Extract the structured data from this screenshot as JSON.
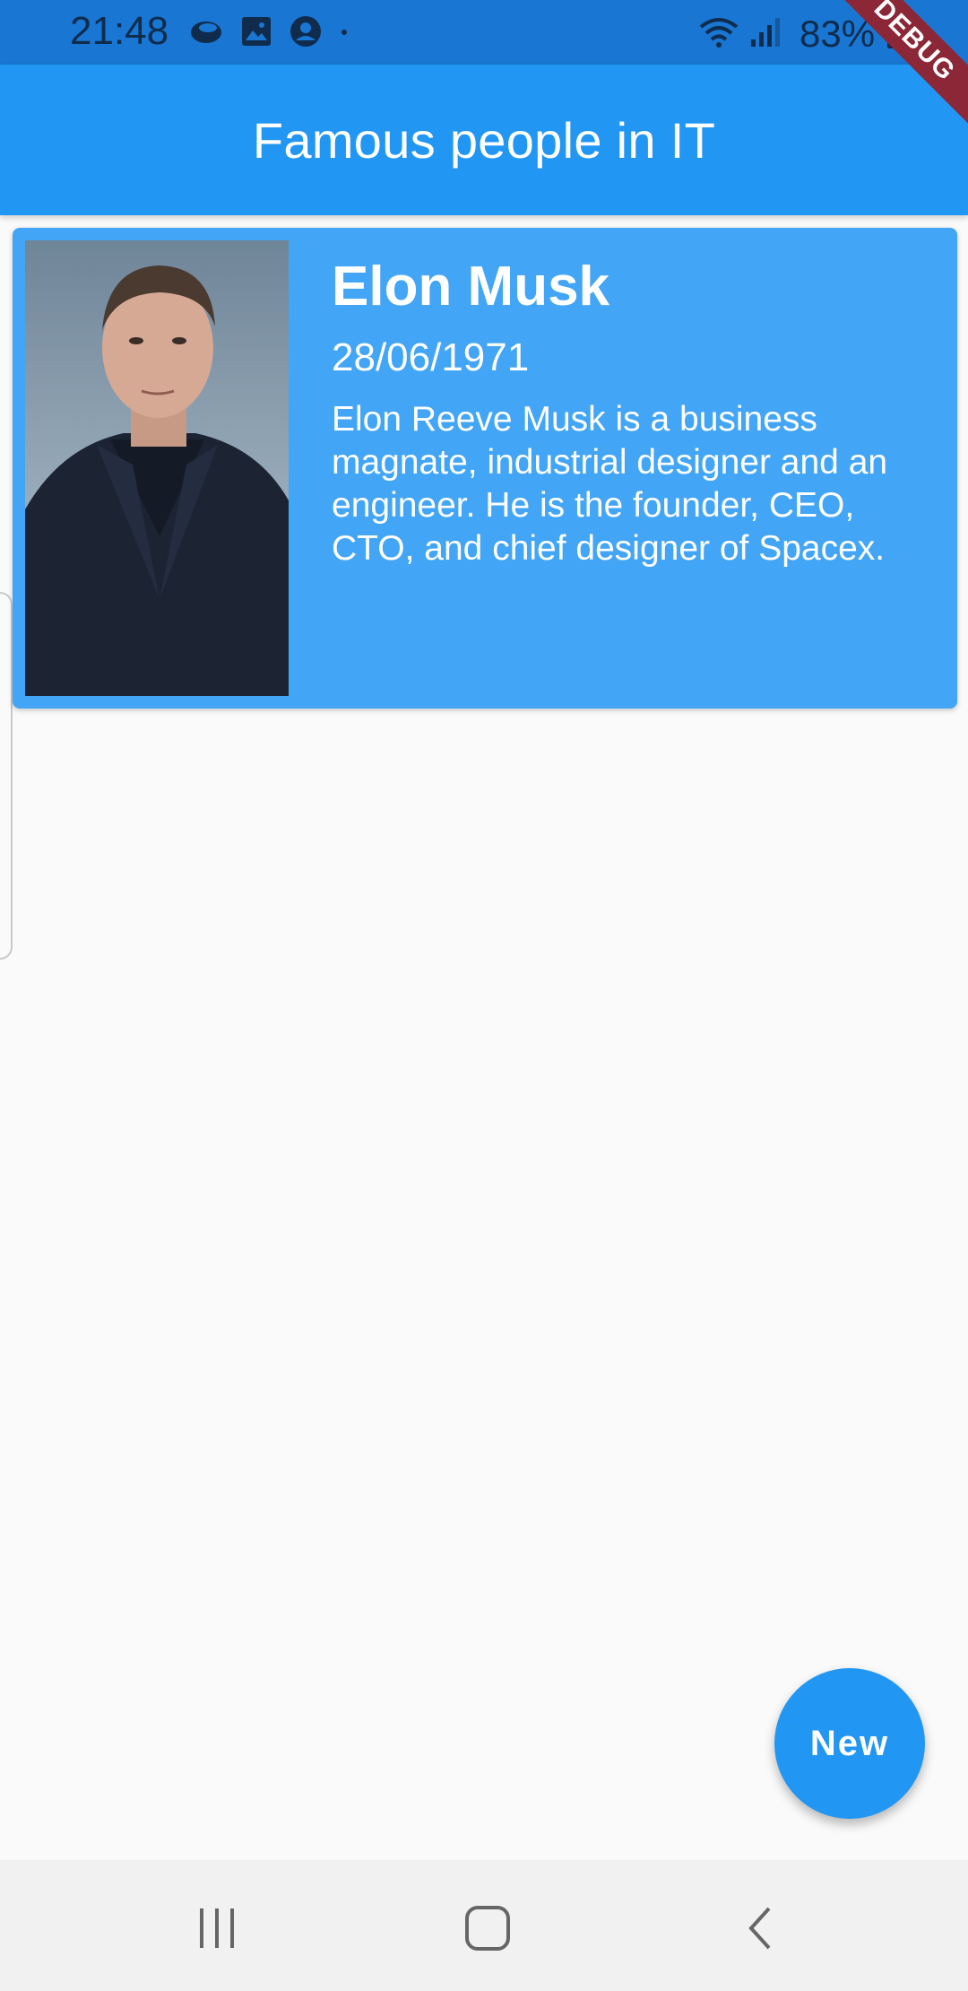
{
  "status_bar": {
    "time": "21:48",
    "battery": "83%",
    "icons": [
      "cloud-icon",
      "image-icon",
      "account-icon",
      "dot-icon",
      "wifi-icon",
      "signal-icon",
      "battery-icon"
    ]
  },
  "debug_banner": "DEBUG",
  "app_bar": {
    "title": "Famous people in IT"
  },
  "people": [
    {
      "name": "Elon Musk",
      "date": "28/06/1971",
      "description": "Elon Reeve Musk is a business magnate, industrial designer and an engineer. He is the founder, CEO, CTO, and chief designer of Spacex."
    }
  ],
  "fab": {
    "label": "New"
  },
  "nav_bar": {
    "buttons": [
      "recents-icon",
      "home-icon",
      "back-icon"
    ]
  },
  "colors": {
    "primary": "#2196f3",
    "card": "#42a5f5",
    "status_bar": "#1976d2",
    "background": "#fafafa"
  }
}
